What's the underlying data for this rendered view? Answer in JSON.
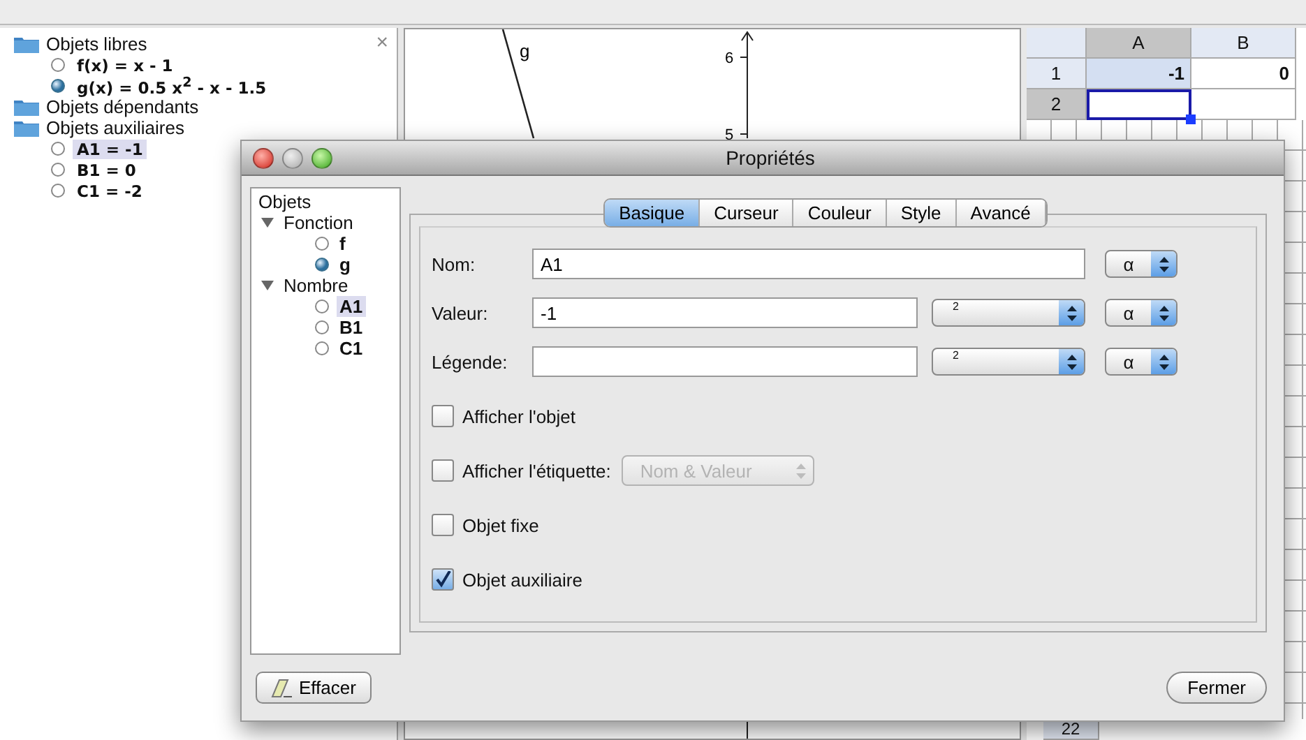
{
  "algebra": {
    "close_label": "×",
    "groups": [
      {
        "label": "Objets libres",
        "items": [
          {
            "text": "f(x) = x - 1",
            "shown": false,
            "selected": false
          },
          {
            "text": "g(x) = 0.5 x$^{2}$ - x - 1.5",
            "shown": true,
            "selected": false
          }
        ]
      },
      {
        "label": "Objets dépendants"
      },
      {
        "label": "Objets auxiliaires",
        "items": [
          {
            "text": "A1 = -1",
            "shown": false,
            "selected": true
          },
          {
            "text": "B1 = 0",
            "shown": false,
            "selected": false
          },
          {
            "text": "C1 = -2",
            "shown": false,
            "selected": false
          }
        ]
      }
    ]
  },
  "graphics": {
    "curve_label": "g",
    "y_ticks": [
      "6",
      "5"
    ]
  },
  "spreadsheet": {
    "columns": [
      {
        "label": "A",
        "selected": true
      },
      {
        "label": "B",
        "selected": false
      }
    ],
    "rows": [
      {
        "label": "1",
        "selected": false,
        "cells": [
          {
            "text": "-1",
            "highlighted": true,
            "active": false
          },
          {
            "text": "0",
            "highlighted": false,
            "active": false
          }
        ]
      },
      {
        "label": "2",
        "selected": true,
        "cells": [
          {
            "highlighted": false,
            "active": true
          },
          {
            "highlighted": false,
            "active": false
          }
        ]
      }
    ],
    "bottom_row": "22"
  },
  "dialog": {
    "title": "Propriétés",
    "tree": {
      "label": "Objets",
      "groups": [
        {
          "label": "Fonction",
          "expanded": true,
          "items": [
            {
              "label": "f",
              "shown": false,
              "selected": false
            },
            {
              "label": "g",
              "shown": true,
              "selected": false
            }
          ]
        },
        {
          "label": "Nombre",
          "expanded": true,
          "items": [
            {
              "label": "A1",
              "shown": false,
              "selected": true
            },
            {
              "label": "B1",
              "shown": false,
              "selected": false
            },
            {
              "label": "C1",
              "shown": false,
              "selected": false
            }
          ]
        }
      ]
    },
    "tabs": [
      {
        "label": "Basique",
        "selected": true
      },
      {
        "label": "Curseur",
        "selected": false
      },
      {
        "label": "Couleur",
        "selected": false
      },
      {
        "label": "Style",
        "selected": false
      },
      {
        "label": "Avancé",
        "selected": false
      }
    ],
    "fields": [
      {
        "label": "Nom:",
        "value": "A1",
        "symbol": "α"
      },
      {
        "label": "Valeur:",
        "value": "-1",
        "precision": "2",
        "symbol": "α"
      },
      {
        "label": "Légende:",
        "precision": "2",
        "symbol": "α"
      }
    ],
    "options": [
      {
        "kind": "checkbox",
        "label": "Afficher l'objet",
        "checked": false
      },
      {
        "kind": "checkbox-select",
        "label": "Afficher l'étiquette:",
        "checked": false,
        "select": {
          "value": "Nom & Valeur",
          "disabled": true
        }
      },
      {
        "kind": "checkbox",
        "label": "Objet fixe",
        "checked": false
      },
      {
        "kind": "checkbox",
        "label": "Objet auxiliaire",
        "checked": true
      }
    ],
    "delete_button": "Effacer",
    "close_button": "Fermer"
  }
}
